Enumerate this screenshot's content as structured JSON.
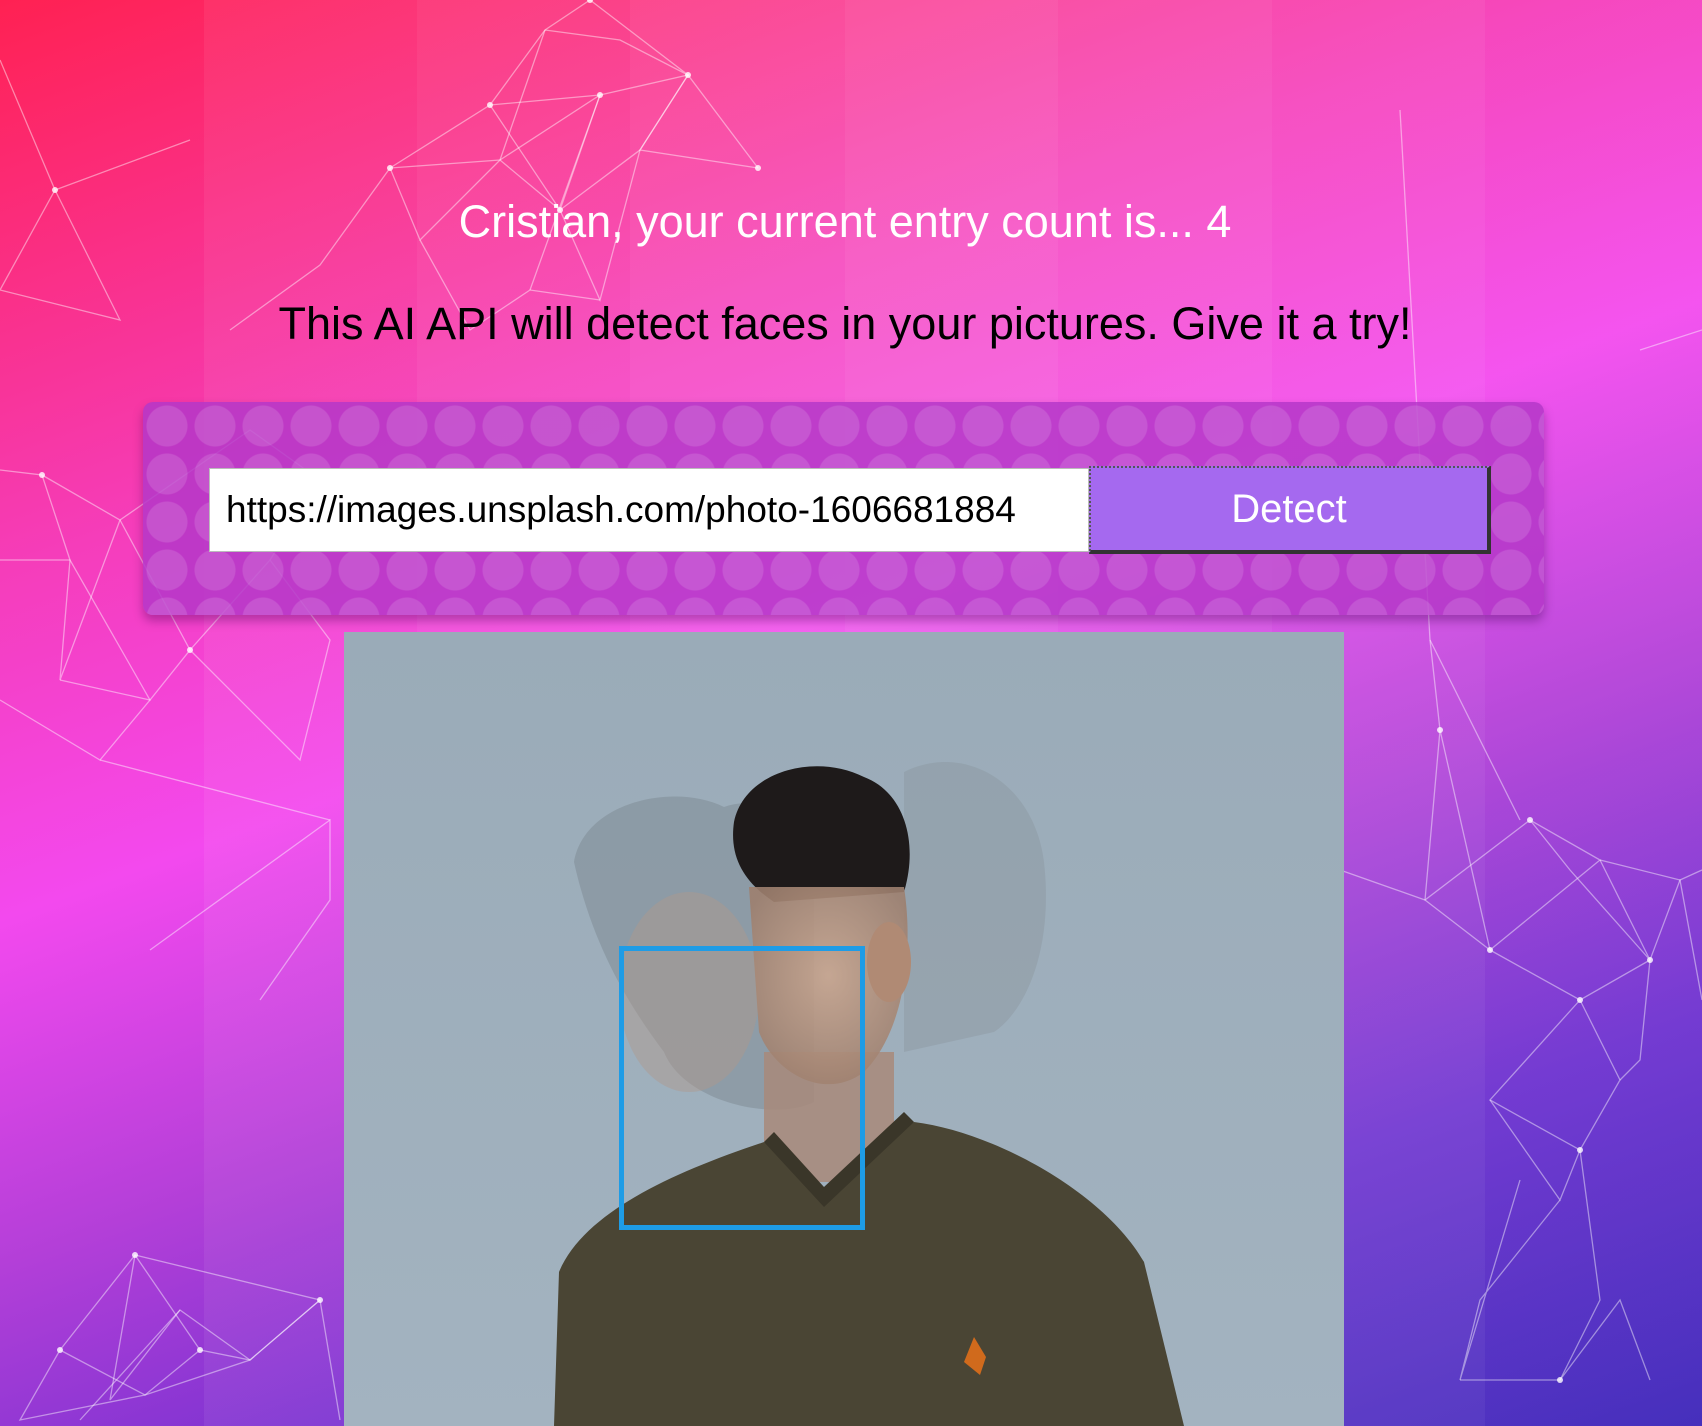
{
  "rank": {
    "user_name": "Cristian",
    "entry_count_text": "Cristian, your current entry count is... 4",
    "entries": "4"
  },
  "tagline": "This AI API will detect faces in your pictures. Give it a try!",
  "form": {
    "url_value": "https://images.unsplash.com/photo-1606681884",
    "detect_label": "Detect"
  },
  "face_detection": {
    "box_color": "#1e9ce6",
    "faces_detected": 1
  },
  "colors": {
    "button": "#a569ef",
    "card": "#b437c8"
  }
}
